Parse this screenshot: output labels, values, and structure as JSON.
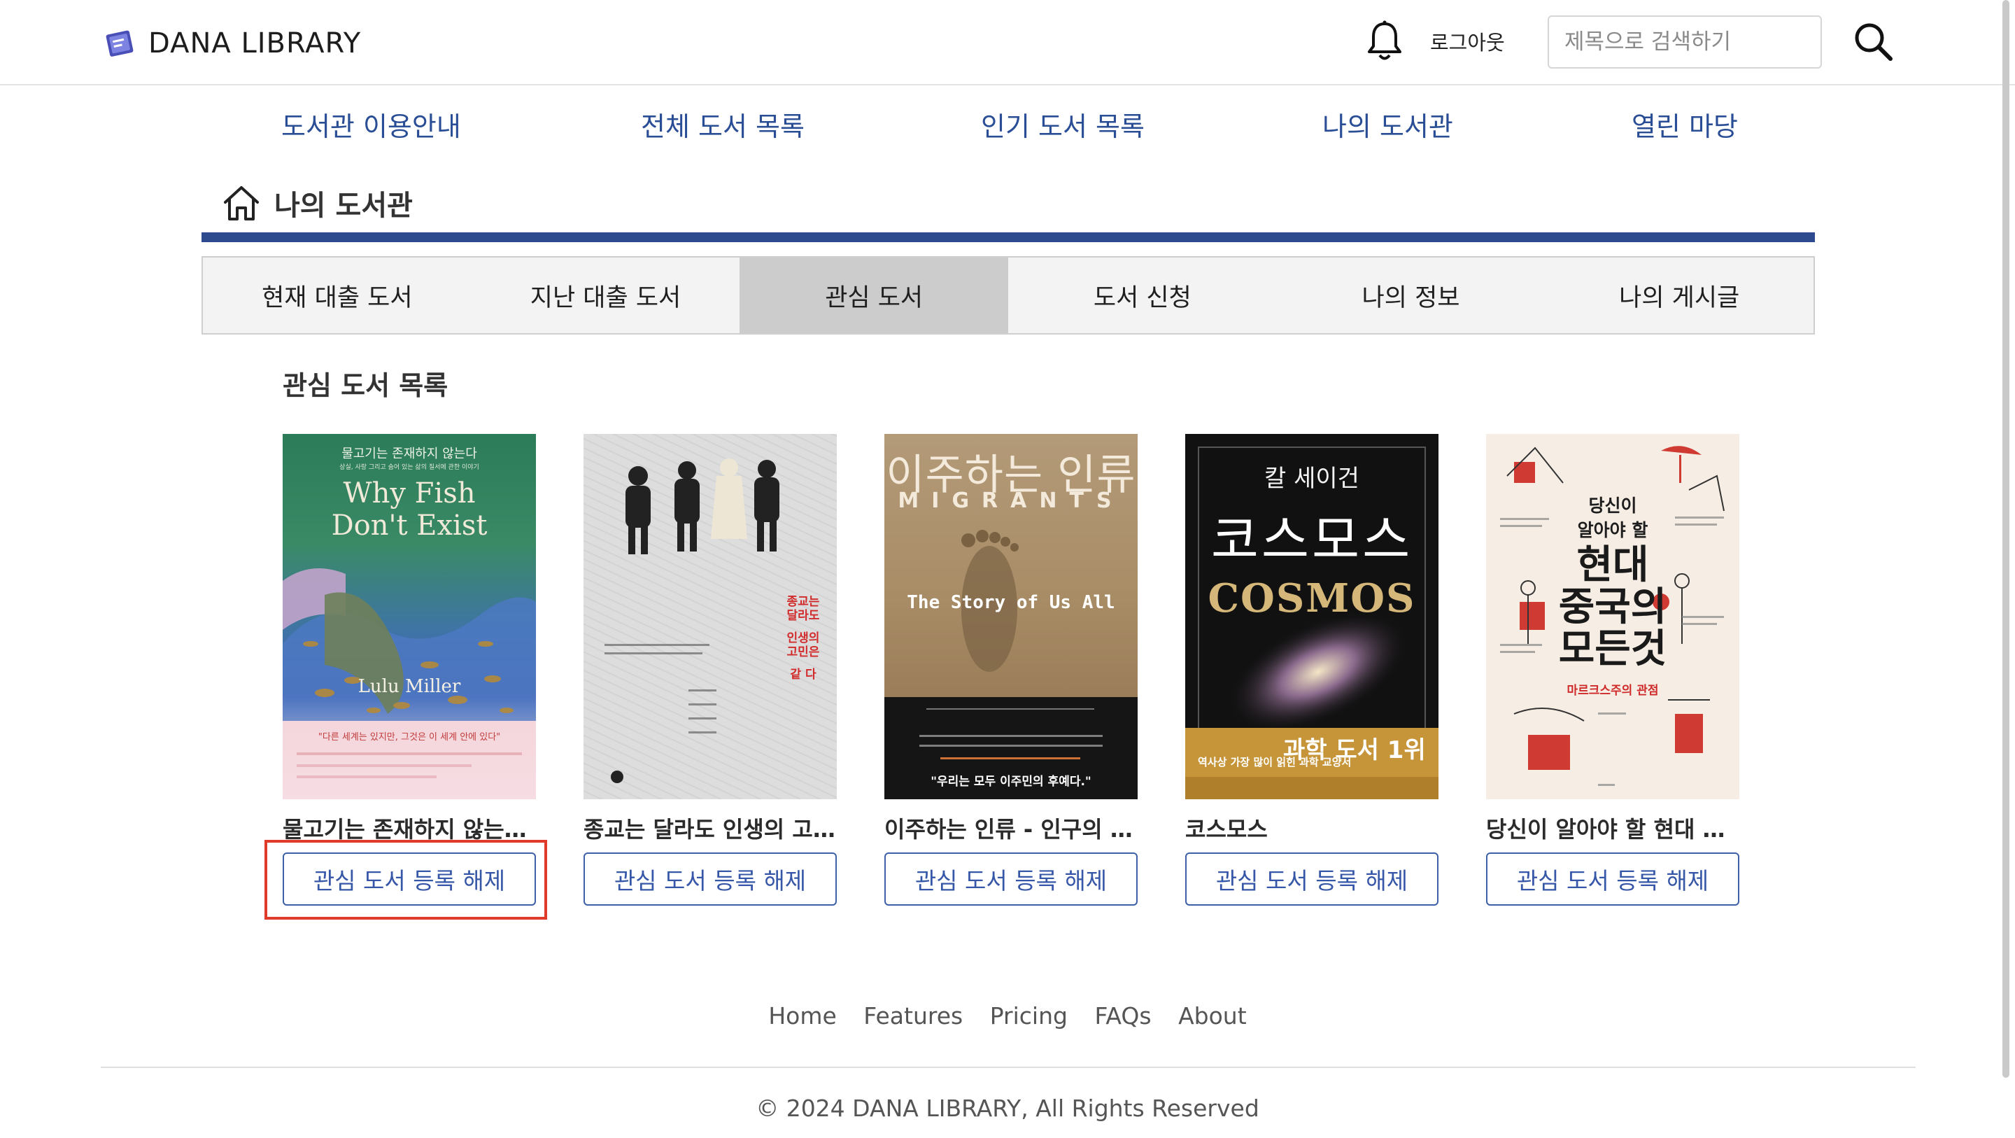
{
  "header": {
    "logo_text": "DANA LIBRARY",
    "logout_label": "로그아웃",
    "search_placeholder": "제목으로 검색하기"
  },
  "nav": {
    "items": [
      "도서관 이용안내",
      "전체 도서 목록",
      "인기 도서 목록",
      "나의 도서관",
      "열린 마당"
    ]
  },
  "section": {
    "title": "나의 도서관"
  },
  "tabs": {
    "items": [
      "현재 대출 도서",
      "지난 대출 도서",
      "관심 도서",
      "도서 신청",
      "나의 정보",
      "나의 게시글"
    ],
    "active_index": 2
  },
  "favorites": {
    "title": "관심 도서 목록",
    "button_label": "관심 도서 등록 해제",
    "books": [
      {
        "title": "물고기는 존재하지 않는…",
        "cover": {
          "top_line": "물고기는 존재하지 않는다",
          "sub_line": "상실, 사랑 그리고 숨어 있는 삶의 질서에 관한 이야기",
          "en_title_1": "Why Fish",
          "en_title_2": "Don't Exist",
          "author": "Lulu Miller",
          "quote": "\"다른 세계는 있지만, 그것은 이 세계 안에 있다\"",
          "accent": "#2f7a55"
        }
      },
      {
        "title": "종교는 달라도 인생의 고…",
        "cover": {
          "red_1": "종교는",
          "red_2": "달라도",
          "red_3": "인생의",
          "red_4": "고민은",
          "red_5": "같 다"
        }
      },
      {
        "title": "이주하는 인류 - 인구의 …",
        "cover": {
          "kr_title": "이주하는 인류",
          "en_title": "MIGRANTS",
          "tagline": "The Story of Us All",
          "quote": "\"우리는 모두 이주민의 후예다.\""
        }
      },
      {
        "title": "코스모스",
        "cover": {
          "author": "칼 세이건",
          "kr_title": "코스모스",
          "en_title": "COSMOS",
          "banner": "과학 도서 1위",
          "banner_small": "역사상 가장 많이 읽힌 과학 교양서"
        }
      },
      {
        "title": "당신이 알아야 할 현대 …",
        "cover": {
          "line_1": "당신이",
          "line_2": "알아야 할",
          "big_1": "현대",
          "big_2": "중국의",
          "big_3": "모든것",
          "red_sub": "마르크스주의 관점"
        }
      }
    ]
  },
  "footer": {
    "links": [
      "Home",
      "Features",
      "Pricing",
      "FAQs",
      "About"
    ],
    "copyright": "© 2024 DANA LIBRARY, All Rights Reserved"
  }
}
